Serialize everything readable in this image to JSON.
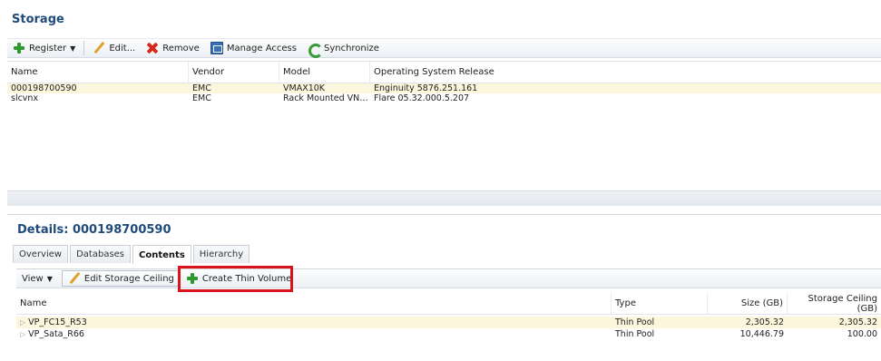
{
  "storage": {
    "title": "Storage",
    "toolbar": {
      "register_label": "Register",
      "edit_label": "Edit...",
      "remove_label": "Remove",
      "manage_access_label": "Manage Access",
      "synchronize_label": "Synchronize"
    },
    "columns": [
      "Name",
      "Vendor",
      "Model",
      "Operating System Release"
    ],
    "rows": [
      [
        "000198700590",
        "EMC",
        "VMAX10K",
        "Enginuity 5876.251.161"
      ],
      [
        "slcvnx",
        "EMC",
        "Rack Mounted VNX...",
        "Flare 05.32.000.5.207"
      ]
    ]
  },
  "details": {
    "title": "Details: 000198700590",
    "tabs": [
      "Overview",
      "Databases",
      "Contents",
      "Hierarchy"
    ],
    "active_tab": "Contents",
    "toolbar": {
      "view_label": "View",
      "edit_ceiling_label": "Edit Storage Ceiling",
      "create_thin_label": "Create Thin Volume"
    },
    "columns": [
      "Name",
      "Type",
      "Size (GB)",
      "Storage Ceiling (GB)"
    ],
    "rows": [
      [
        "VP_FC15_R53",
        "Thin Pool",
        "2,305.32",
        "2,305.32"
      ],
      [
        "VP_Sata_R66",
        "Thin Pool",
        "10,446.79",
        "100.00"
      ]
    ]
  },
  "colors": {
    "title": "#1e4b7a",
    "selection": "#fbf6dc",
    "highlight_box": "#d9151b",
    "add_icon": "#2e9a2e",
    "remove_icon": "#d8261c"
  },
  "icons": [
    "plus-icon",
    "pencil-icon",
    "x-icon",
    "manage-access-icon",
    "synchronize-icon",
    "chevron-down-icon",
    "tree-expand-icon"
  ]
}
